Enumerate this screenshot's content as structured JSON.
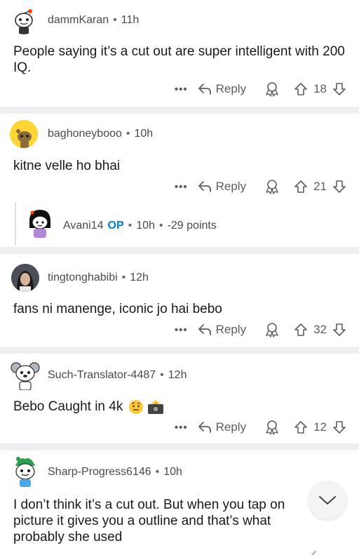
{
  "comments": [
    {
      "username": "dammKaran",
      "time": "11h",
      "body": "People saying it’s a cut out are super intelligent with 200 IQ.",
      "more": "•••",
      "reply": "Reply",
      "score": "18",
      "avatar": "snoo-avatar-icon"
    },
    {
      "username": "baghoneybooo",
      "time": "10h",
      "body": "kitne velle ho bhai",
      "more": "•••",
      "reply": "Reply",
      "score": "21",
      "avatar": "snoo-yellow-avatar-icon"
    },
    {
      "username": "tingtonghabibi",
      "time": "12h",
      "body": "fans ni manenge, iconic jo hai bebo",
      "more": "•••",
      "reply": "Reply",
      "score": "32",
      "avatar": "photo-avatar"
    },
    {
      "username": "Such-Translator-4487",
      "time": "12h",
      "body": "Bebo Caught in 4k",
      "more": "•••",
      "reply": "Reply",
      "score": "12",
      "avatar": "snoo-koala-avatar-icon"
    },
    {
      "username": "Sharp-Progress6146",
      "time": "10h",
      "body": "I don’t think it’s a cut out. But when you tap on picture it gives you a outline and that’s what probably she used",
      "avatar": "snoo-green-avatar-icon"
    }
  ],
  "collapsed_reply": {
    "username": "Avani14",
    "op_badge": "OP",
    "time": "10h",
    "points": "-29 points"
  },
  "icons": {
    "reply": "reply-arrow-icon",
    "award": "award-icon",
    "upvote": "upvote-arrow-icon",
    "downvote": "downvote-arrow-icon",
    "scroll": "chevron-down-icon",
    "emoji_smirk": "raised-eyebrow-emoji",
    "emoji_camera": "camera-flash-emoji"
  },
  "colors": {
    "op": "#0079d3",
    "separator": "#edeff1",
    "text": "#1a1a1b",
    "muted": "#5e5e5e"
  }
}
